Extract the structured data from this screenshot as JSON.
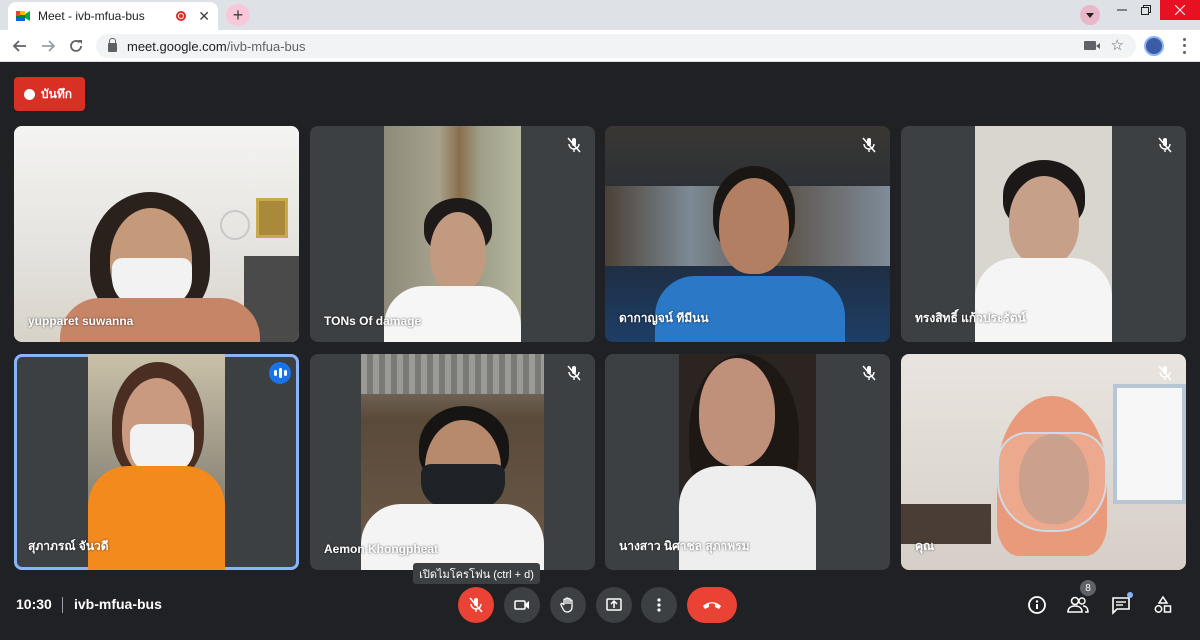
{
  "browser": {
    "tab_title": "Meet - ivb-mfua-bus",
    "url_host": "meet.google.com",
    "url_path": "/ivb-mfua-bus",
    "new_tab_glyph": "+",
    "close_glyph": "✕"
  },
  "meet": {
    "record_label": "บันทึก",
    "tooltip": "เปิดไมโครโฟน (ctrl + d)",
    "time": "10:30",
    "meeting_code": "ivb-mfua-bus",
    "people_count": "8",
    "participants": [
      {
        "name": "yupparet suwanna",
        "muted": false,
        "speaking": false
      },
      {
        "name": "TONs Of damage",
        "muted": true,
        "speaking": false
      },
      {
        "name": "ดากาญจน์ ทีมีนน",
        "muted": true,
        "speaking": false
      },
      {
        "name": "ทรงสิทธิ์ แก้วประรัตน์",
        "muted": true,
        "speaking": false
      },
      {
        "name": "สุภาภรณ์ จันวดี",
        "muted": false,
        "speaking": true
      },
      {
        "name": "Aemon Khongpheat",
        "muted": true,
        "speaking": false
      },
      {
        "name": "นางสาว นิศาชล สุภาพรม",
        "muted": true,
        "speaking": false
      },
      {
        "name": "คุณ",
        "muted": true,
        "speaking": false
      }
    ]
  },
  "colors": {
    "accent_red": "#ea4335",
    "record_red": "#d93025",
    "speaking_blue": "#1a73e8",
    "background": "#202124",
    "tile": "#3c4043"
  }
}
